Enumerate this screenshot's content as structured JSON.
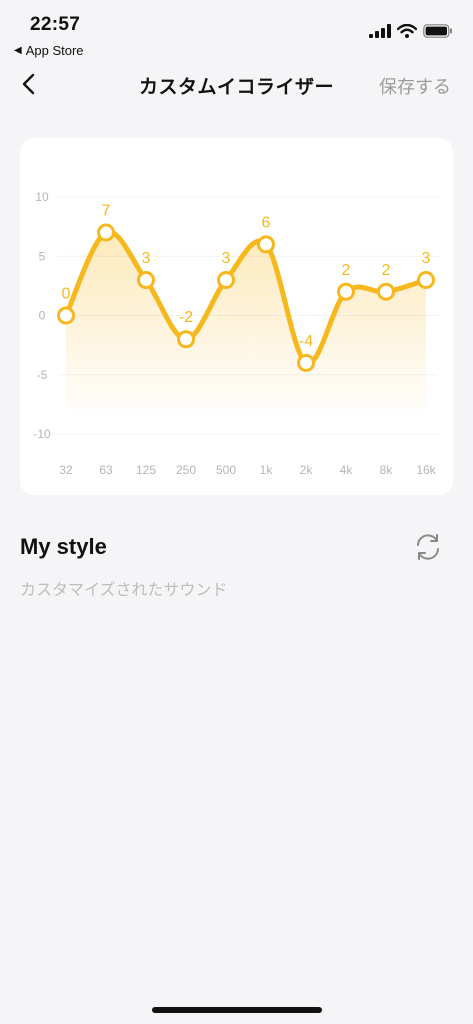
{
  "status": {
    "time": "22:57",
    "back_app": "App Store"
  },
  "nav": {
    "title": "カスタムイコライザー",
    "save_label": "保存する"
  },
  "preset": {
    "name": "My style",
    "subtitle": "カスタマイズされたサウンド"
  },
  "colors": {
    "accent": "#f7b81e",
    "text": "#111111",
    "muted": "#9b9b9b",
    "background": "#f5f5f7"
  },
  "icons": [
    "chevron-left-icon",
    "refresh-icon",
    "signal-icon",
    "wifi-icon",
    "battery-icon"
  ],
  "chart_data": {
    "type": "line",
    "categories": [
      "32",
      "63",
      "125",
      "250",
      "500",
      "1k",
      "2k",
      "4k",
      "8k",
      "16k"
    ],
    "values": [
      0,
      7,
      3,
      -2,
      3,
      6,
      -4,
      2,
      2,
      3
    ],
    "yticks": [
      "10",
      "5",
      "0",
      "-5",
      "-10"
    ],
    "ylim": [
      -10,
      10
    ],
    "grid": true,
    "smooth": true,
    "area_fill": true
  }
}
